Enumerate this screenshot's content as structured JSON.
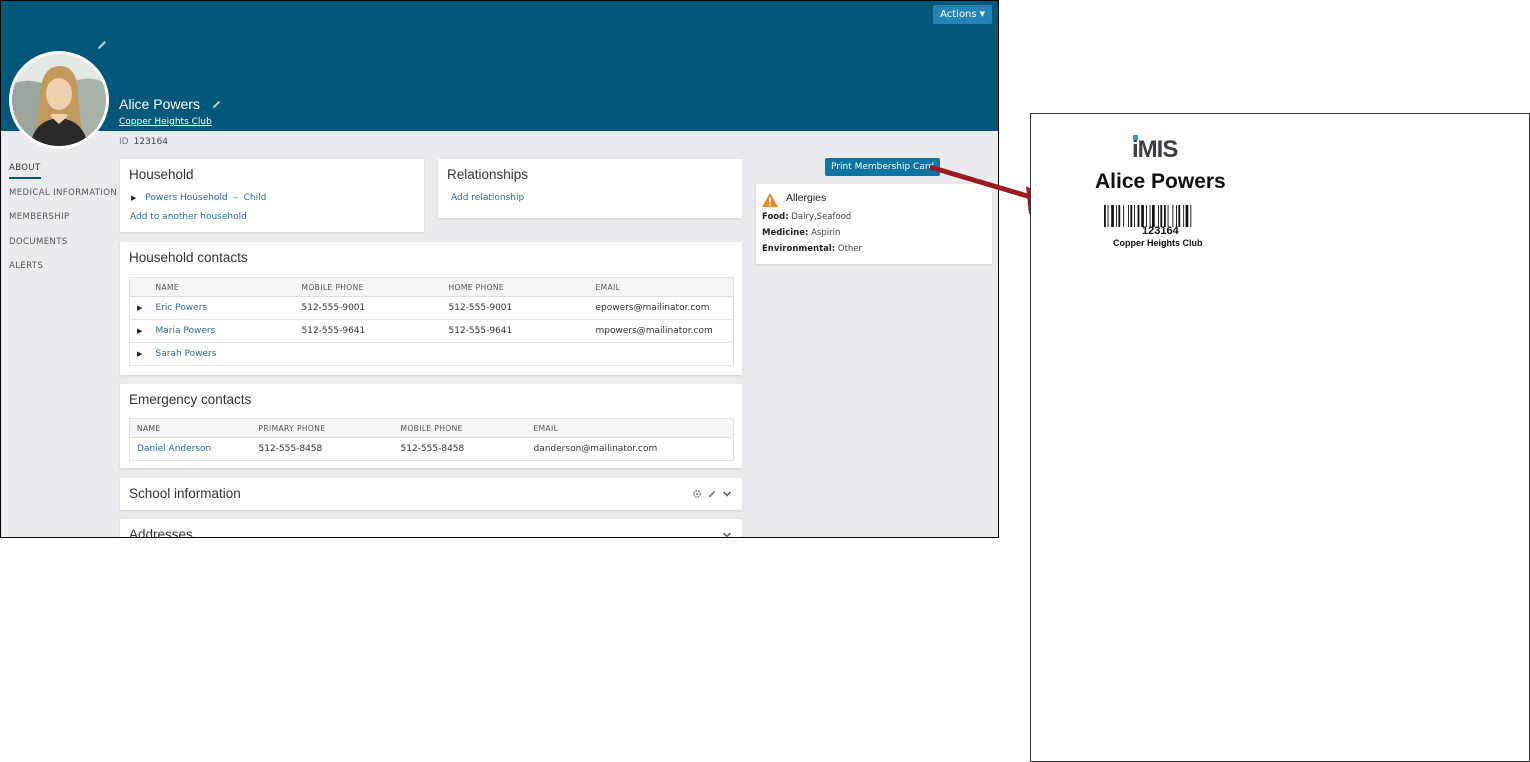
{
  "header": {
    "actions_label": "Actions",
    "name": "Alice Powers",
    "club": "Copper Heights Club",
    "id_label": "ID",
    "id_value": "123164",
    "banner_color": "#03587a"
  },
  "nav": {
    "items": [
      {
        "label": "ABOUT",
        "active": true
      },
      {
        "label": "MEDICAL INFORMATION",
        "active": false
      },
      {
        "label": "MEMBERSHIP",
        "active": false
      },
      {
        "label": "DOCUMENTS",
        "active": false
      },
      {
        "label": "ALERTS",
        "active": false
      }
    ]
  },
  "household": {
    "title": "Household",
    "entry_name": "Powers Household",
    "entry_sep": "–",
    "entry_role": "Child",
    "add_link": "Add to another household"
  },
  "relationships": {
    "title": "Relationships",
    "add_link": "Add relationship"
  },
  "household_contacts": {
    "title": "Household contacts",
    "columns": [
      "NAME",
      "MOBILE PHONE",
      "HOME PHONE",
      "EMAIL"
    ],
    "rows": [
      {
        "name": "Eric Powers",
        "mobile": "512-555-9001",
        "home": "512-555-9001",
        "email": "epowers@mailinator.com"
      },
      {
        "name": "Maria Powers",
        "mobile": "512-555-9641",
        "home": "512-555-9641",
        "email": "mpowers@mailinator.com"
      },
      {
        "name": "Sarah Powers",
        "mobile": "",
        "home": "",
        "email": ""
      }
    ]
  },
  "emergency_contacts": {
    "title": "Emergency contacts",
    "columns": [
      "NAME",
      "PRIMARY PHONE",
      "MOBILE PHONE",
      "EMAIL"
    ],
    "rows": [
      {
        "name": "Daniel Anderson",
        "primary": "512-555-8458",
        "mobile": "512-555-8458",
        "email": "danderson@mailinator.com"
      }
    ]
  },
  "school": {
    "title": "School information"
  },
  "addresses": {
    "title": "Addresses"
  },
  "print_button": "Print Membership Card",
  "allergies": {
    "title": "Allergies",
    "food_label": "Food:",
    "food_value": "Dairy,Seafood",
    "medicine_label": "Medicine:",
    "medicine_value": "Aspirin",
    "environmental_label": "Environmental:",
    "environmental_value": "Other",
    "warning_color": "#e8891c"
  },
  "card": {
    "logo": "iMIS",
    "name": "Alice Powers",
    "id": "123164",
    "club": "Copper Heights Club"
  },
  "icons": {
    "pencil": "pencil-icon",
    "gear": "gear-icon",
    "chevron": "chevron-down-icon",
    "warning": "warning-icon",
    "arrow_color": "#9b1b22"
  }
}
